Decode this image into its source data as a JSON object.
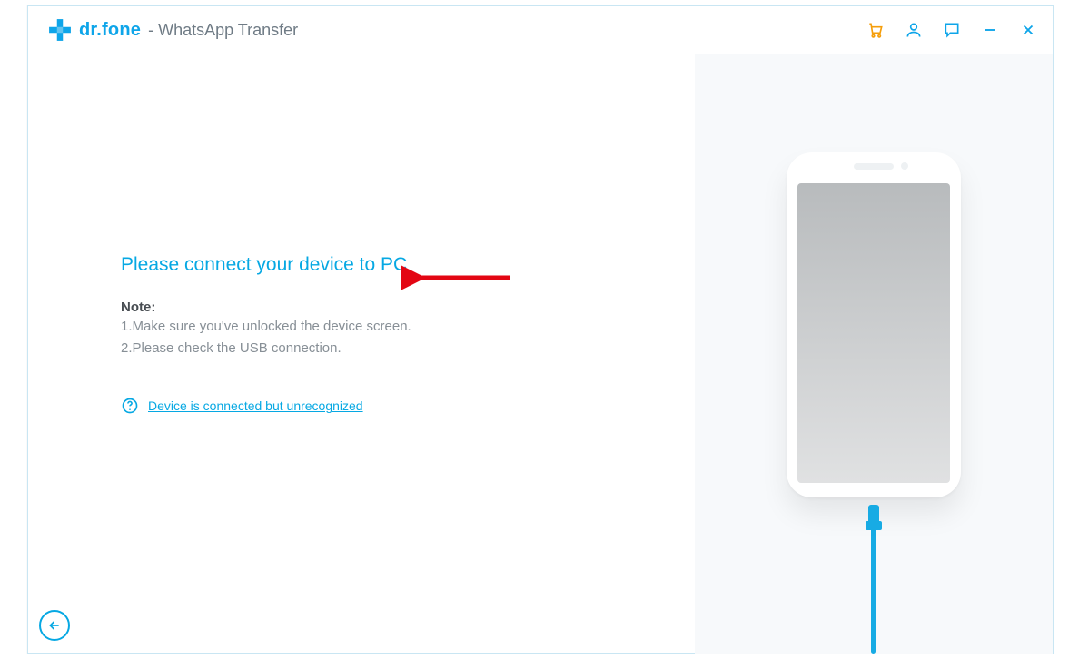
{
  "header": {
    "brand": "dr.fone",
    "subtitle": " - WhatsApp Transfer"
  },
  "main": {
    "heading": "Please connect your device to PC",
    "note_label": "Note:",
    "note_1": "1.Make sure you've unlocked the device screen.",
    "note_2": "2.Please check the USB connection.",
    "help_link": "Device is connected but unrecognized"
  }
}
